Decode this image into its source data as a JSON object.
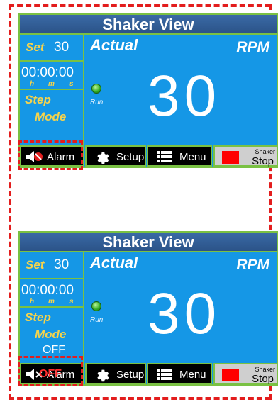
{
  "panels": [
    {
      "title": "Shaker View",
      "set_label": "Set",
      "set_value": "30",
      "time": "00:00:00",
      "h": "h",
      "m": "m",
      "s": "s",
      "step_label": "Step",
      "mode_label": "Mode",
      "mode_value": "",
      "actual_label": "Actual",
      "rpm_label": "RPM",
      "run_label": "Run",
      "rpm_value": "30",
      "buttons": {
        "alarm": "Alarm",
        "setup": "Setup",
        "menu": "Menu",
        "shaker_small": "Shaker",
        "shaker_stop": "Stop",
        "alarm_overlay": ""
      }
    },
    {
      "title": "Shaker View",
      "set_label": "Set",
      "set_value": "30",
      "time": "00:00:00",
      "h": "h",
      "m": "m",
      "s": "s",
      "step_label": "Step",
      "mode_label": "Mode",
      "mode_value": "OFF",
      "actual_label": "Actual",
      "rpm_label": "RPM",
      "run_label": "Run",
      "rpm_value": "30",
      "buttons": {
        "alarm": "Alarm",
        "setup": "Setup",
        "menu": "Menu",
        "shaker_small": "Shaker",
        "shaker_stop": "Stop",
        "alarm_overlay": "OFF"
      }
    }
  ],
  "colors": {
    "panel_bg": "#1597e6",
    "title_bg": "#2b5388",
    "accent_green": "#7ac143",
    "label_yellow": "#f5d34c",
    "highlight_red": "#e31d1d",
    "led_green": "#2ea81f"
  },
  "icons": [
    "speaker-muted-icon",
    "gear-icon",
    "menu-list-icon",
    "stop-square-icon",
    "run-led-icon"
  ]
}
